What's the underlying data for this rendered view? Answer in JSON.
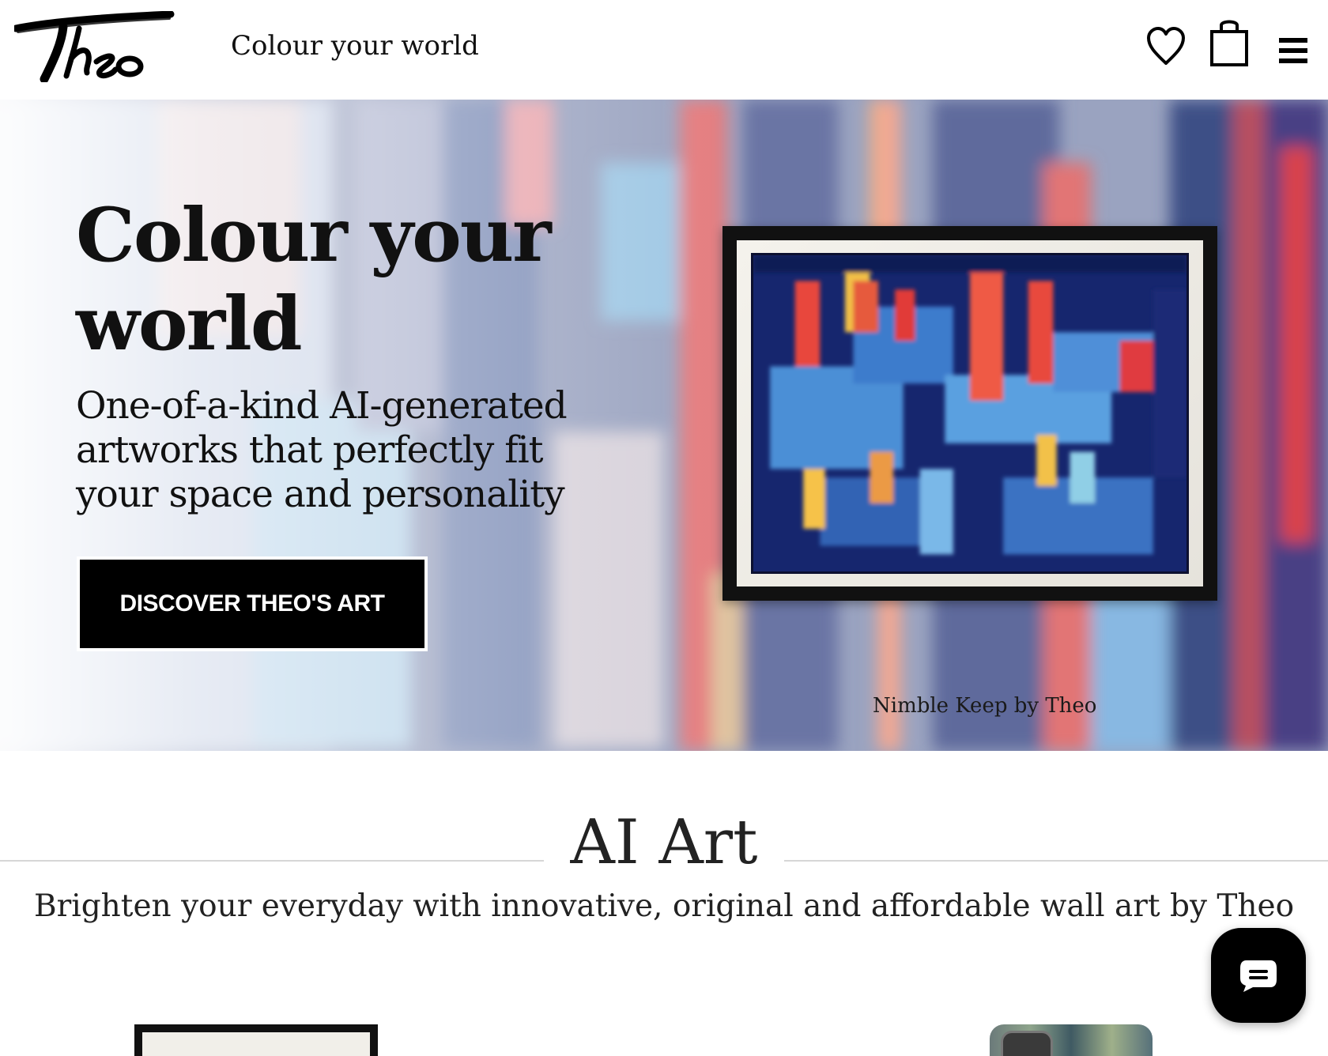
{
  "header": {
    "logo_text": "Theo",
    "tagline": "Colour your world",
    "icons": [
      "heart-icon",
      "shopping-bag-icon",
      "menu-icon"
    ]
  },
  "hero": {
    "title": "Colour your world",
    "subtitle": "One-of-a-kind AI-generated artworks that perfectly fit your space and personality",
    "cta_label": "DISCOVER THEO'S ART",
    "artwork_caption": "Nimble Keep by Theo"
  },
  "section": {
    "title": "AI Art",
    "subtitle": "Brighten your everyday with innovative, original and affordable wall art by Theo"
  },
  "chat": {
    "icon": "chat-icon"
  },
  "colors": {
    "text": "#111111",
    "cta_background": "#000000",
    "cta_text": "#ffffff",
    "rule": "#d6d6d6"
  }
}
